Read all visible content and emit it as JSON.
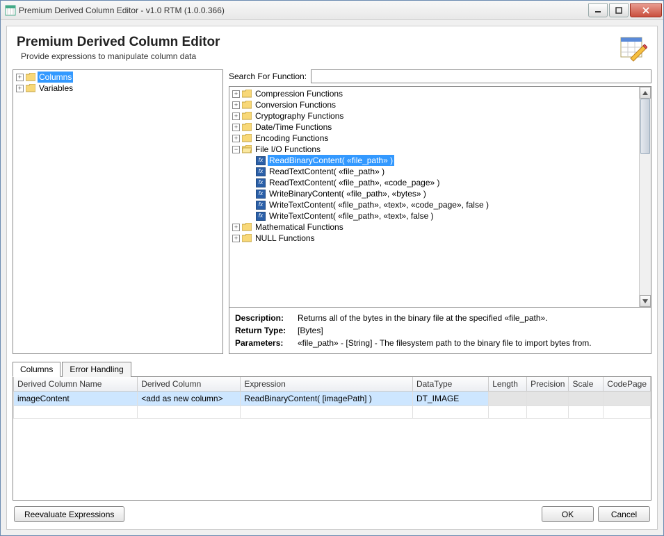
{
  "window": {
    "title": "Premium Derived Column Editor - v1.0 RTM (1.0.0.366)"
  },
  "header": {
    "title": "Premium Derived Column Editor",
    "subtitle": "Provide expressions to manipulate column data"
  },
  "left_tree": {
    "columns": "Columns",
    "variables": "Variables"
  },
  "search": {
    "label": "Search For Function:",
    "value": ""
  },
  "func_tree": {
    "categories": [
      "Compression Functions",
      "Conversion Functions",
      "Cryptography Functions",
      "Date/Time Functions",
      "Encoding Functions",
      "File I/O Functions",
      "Mathematical Functions",
      "NULL Functions"
    ],
    "fileio": [
      "ReadBinaryContent( «file_path» )",
      "ReadTextContent( «file_path» )",
      "ReadTextContent( «file_path», «code_page» )",
      "WriteBinaryContent( «file_path», «bytes» )",
      "WriteTextContent( «file_path», «text», «code_page», false )",
      "WriteTextContent( «file_path», «text», false )"
    ]
  },
  "detail": {
    "desc_k": "Description:",
    "desc_v": "Returns all of the bytes in the binary file at the specified «file_path».",
    "ret_k": "Return Type:",
    "ret_v": "[Bytes]",
    "par_k": "Parameters:",
    "par_v": "«file_path» - [String] - The filesystem path to the binary file to import bytes from."
  },
  "tabs": {
    "columns": "Columns",
    "error": "Error Handling"
  },
  "grid": {
    "headers": {
      "name": "Derived Column Name",
      "col": "Derived Column",
      "expr": "Expression",
      "dt": "DataType",
      "len": "Length",
      "prec": "Precision",
      "scale": "Scale",
      "cp": "CodePage"
    },
    "rows": [
      {
        "name": "imageContent",
        "col": "<add as new column>",
        "expr": "ReadBinaryContent( [imagePath] )",
        "dt": "DT_IMAGE",
        "len": "",
        "prec": "",
        "scale": "",
        "cp": ""
      }
    ]
  },
  "footer": {
    "reeval": "Reevaluate Expressions",
    "ok": "OK",
    "cancel": "Cancel"
  }
}
